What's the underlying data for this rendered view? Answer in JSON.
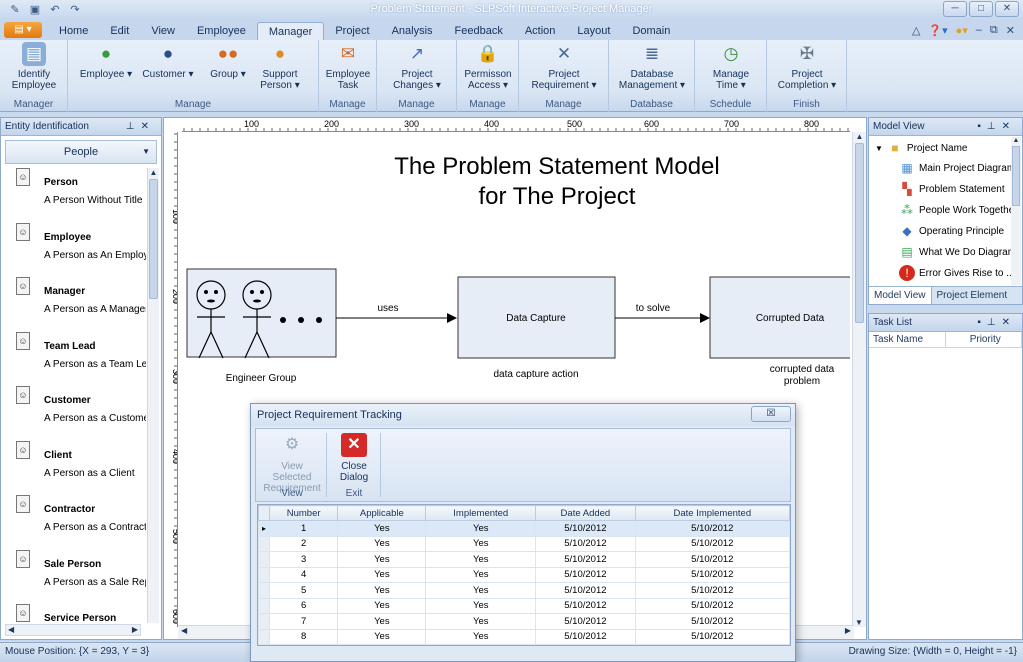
{
  "window": {
    "title": "Problem Statement - SLPSoft Interactive Project Manager"
  },
  "tabs": [
    "Home",
    "Edit",
    "View",
    "Employee",
    "Manager",
    "Project",
    "Analysis",
    "Feedback",
    "Action",
    "Layout",
    "Domain"
  ],
  "ribbon": {
    "groups": [
      {
        "label": "Manager",
        "buttons": [
          {
            "label": "Identify\nEmployee",
            "icon": "id-card-icon"
          }
        ]
      },
      {
        "label": "Manage",
        "buttons": [
          {
            "label": "Employee ▾",
            "icon": "person-icon"
          },
          {
            "label": "Customer ▾",
            "icon": "person-icon"
          },
          {
            "label": "Group ▾",
            "icon": "group-icon"
          },
          {
            "label": "Support\nPerson ▾",
            "icon": "person-icon"
          }
        ]
      },
      {
        "label": "Manage",
        "buttons": [
          {
            "label": "Employee\nTask",
            "icon": "task-icon"
          }
        ]
      },
      {
        "label": "Manage",
        "buttons": [
          {
            "label": "Project\nChanges ▾",
            "icon": "chart-icon"
          }
        ]
      },
      {
        "label": "Manage",
        "buttons": [
          {
            "label": "Permisson\nAccess ▾",
            "icon": "lock-icon"
          }
        ]
      },
      {
        "label": "Manage",
        "buttons": [
          {
            "label": "Project\nRequirement ▾",
            "icon": "tools-icon"
          }
        ]
      },
      {
        "label": "Database",
        "buttons": [
          {
            "label": "Database\nManagement ▾",
            "icon": "database-icon"
          }
        ]
      },
      {
        "label": "Schedule",
        "buttons": [
          {
            "label": "Manage\nTime ▾",
            "icon": "clock-icon"
          }
        ]
      },
      {
        "label": "Finish",
        "buttons": [
          {
            "label": "Project\nCompletion ▾",
            "icon": "wrench-icon"
          }
        ]
      }
    ]
  },
  "left_panel": {
    "title": "Entity Identification",
    "selector": "People",
    "entities": [
      {
        "name": "Person",
        "desc": "A Person Without Title"
      },
      {
        "name": "Employee",
        "desc": "A Person as An Employee"
      },
      {
        "name": "Manager",
        "desc": "A Person as A Manager"
      },
      {
        "name": "Team Lead",
        "desc": "A Person as a Team Lead"
      },
      {
        "name": "Customer",
        "desc": "A Person as a Customer"
      },
      {
        "name": "Client",
        "desc": "A Person as a Client"
      },
      {
        "name": "Contractor",
        "desc": "A Person as a Contractor"
      },
      {
        "name": "Sale Person",
        "desc": "A Person as a Sale Rep"
      },
      {
        "name": "Service Person",
        "desc": ""
      }
    ]
  },
  "ruler": {
    "h": [
      "100",
      "200",
      "300",
      "400",
      "500",
      "600",
      "700",
      "800"
    ],
    "v": [
      "100",
      "200",
      "300",
      "400",
      "500",
      "600"
    ]
  },
  "diagram": {
    "title_line1": "The Problem Statement Model",
    "title_line2": "for The Project",
    "group_label": "Engineer Group",
    "edge1": "uses",
    "box1": "Data Capture",
    "box1_caption": "data capture action",
    "edge2": "to solve",
    "box2": "Corrupted Data",
    "box2_caption_1": "corrupted data",
    "box2_caption_2": "problem"
  },
  "model_view": {
    "title": "Model View",
    "root": "Project Name",
    "items": [
      {
        "label": "Main Project Diagram",
        "icon": "diagram-icon",
        "color": "#4a8fd4"
      },
      {
        "label": "Problem Statement",
        "icon": "problem-icon",
        "color": "#d94a3a"
      },
      {
        "label": "People Work Together",
        "icon": "people-icon",
        "color": "#3aa55a"
      },
      {
        "label": "Operating Principle",
        "icon": "principle-icon",
        "color": "#3a6fc4"
      },
      {
        "label": "What We Do Diagram",
        "icon": "whatwedo-icon",
        "color": "#3aa55a"
      },
      {
        "label": "Error Gives Rise to ...",
        "icon": "error-icon",
        "color": "#d42a1a"
      }
    ],
    "tabs": [
      "Model View",
      "Project Element"
    ]
  },
  "task_list": {
    "title": "Task List",
    "columns": [
      "Task Name",
      "Priority"
    ]
  },
  "status": {
    "left": "Mouse Position: {X = 293,  Y = 3}",
    "right": "Drawing Size: {Width = 0, Height = -1}"
  },
  "dialog": {
    "title": "Project Requirement Tracking",
    "close_x": "☒",
    "view_btn": "View Selected\nRequirement",
    "view_group": "View",
    "close_btn": "Close\nDialog",
    "exit_group": "Exit",
    "columns": [
      "Number",
      "Applicable",
      "Implemented",
      "Date Added",
      "Date Implemented"
    ],
    "rows": [
      [
        "1",
        "Yes",
        "Yes",
        "5/10/2012",
        "5/10/2012"
      ],
      [
        "2",
        "Yes",
        "Yes",
        "5/10/2012",
        "5/10/2012"
      ],
      [
        "3",
        "Yes",
        "Yes",
        "5/10/2012",
        "5/10/2012"
      ],
      [
        "4",
        "Yes",
        "Yes",
        "5/10/2012",
        "5/10/2012"
      ],
      [
        "5",
        "Yes",
        "Yes",
        "5/10/2012",
        "5/10/2012"
      ],
      [
        "6",
        "Yes",
        "Yes",
        "5/10/2012",
        "5/10/2012"
      ],
      [
        "7",
        "Yes",
        "Yes",
        "5/10/2012",
        "5/10/2012"
      ],
      [
        "8",
        "Yes",
        "Yes",
        "5/10/2012",
        "5/10/2012"
      ]
    ]
  }
}
